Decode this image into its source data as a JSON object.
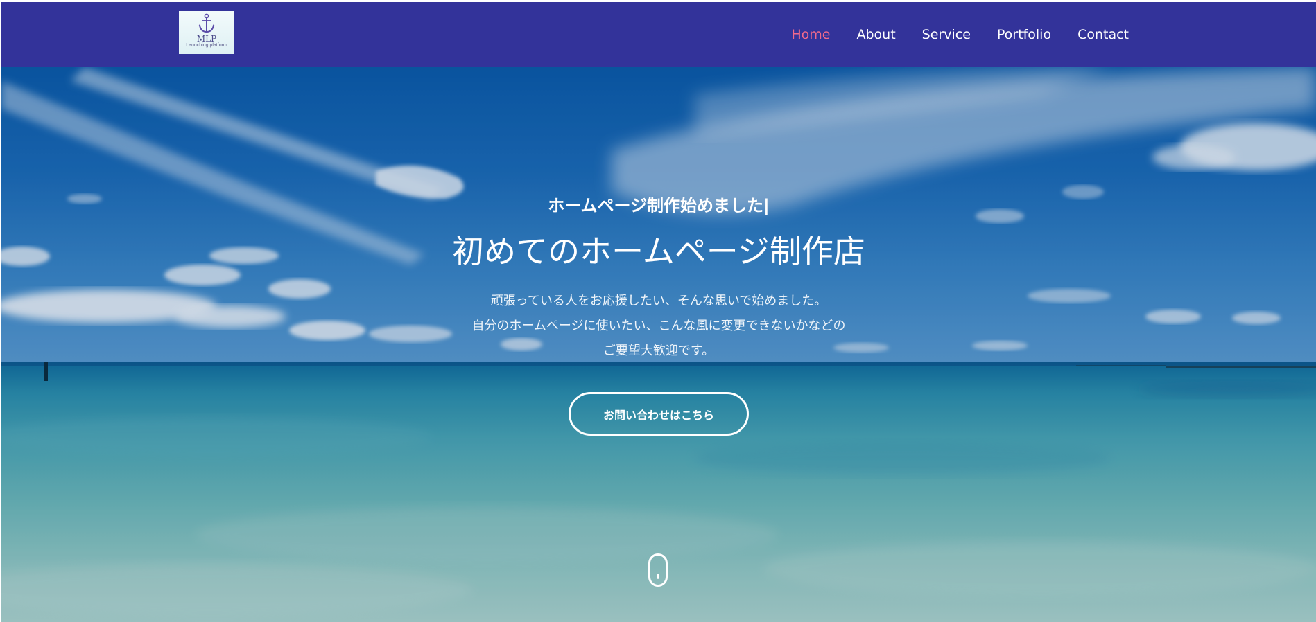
{
  "logo": {
    "mark": "MLP",
    "subtitle": "Launching platform",
    "icon": "anchor-icon"
  },
  "nav": {
    "items": [
      {
        "label": "Home",
        "active": true
      },
      {
        "label": "About",
        "active": false
      },
      {
        "label": "Service",
        "active": false
      },
      {
        "label": "Portfolio",
        "active": false
      },
      {
        "label": "Contact",
        "active": false
      }
    ]
  },
  "hero": {
    "subtitle": "ホームページ制作始めました|",
    "title": "初めてのホームページ制作店",
    "description": [
      "頑張っている人をお応援したい、そんな思いで始めました。",
      "自分のホームページに使いたい、こんな風に変更できないかなどの",
      "ご要望大歓迎です。"
    ],
    "cta_label": "お問い合わせはこちら",
    "scroll_icon": "mouse-scroll-icon"
  },
  "colors": {
    "navbar_bg": "#33339a",
    "nav_active": "#f06a8c",
    "nav_text": "#ffffff"
  }
}
